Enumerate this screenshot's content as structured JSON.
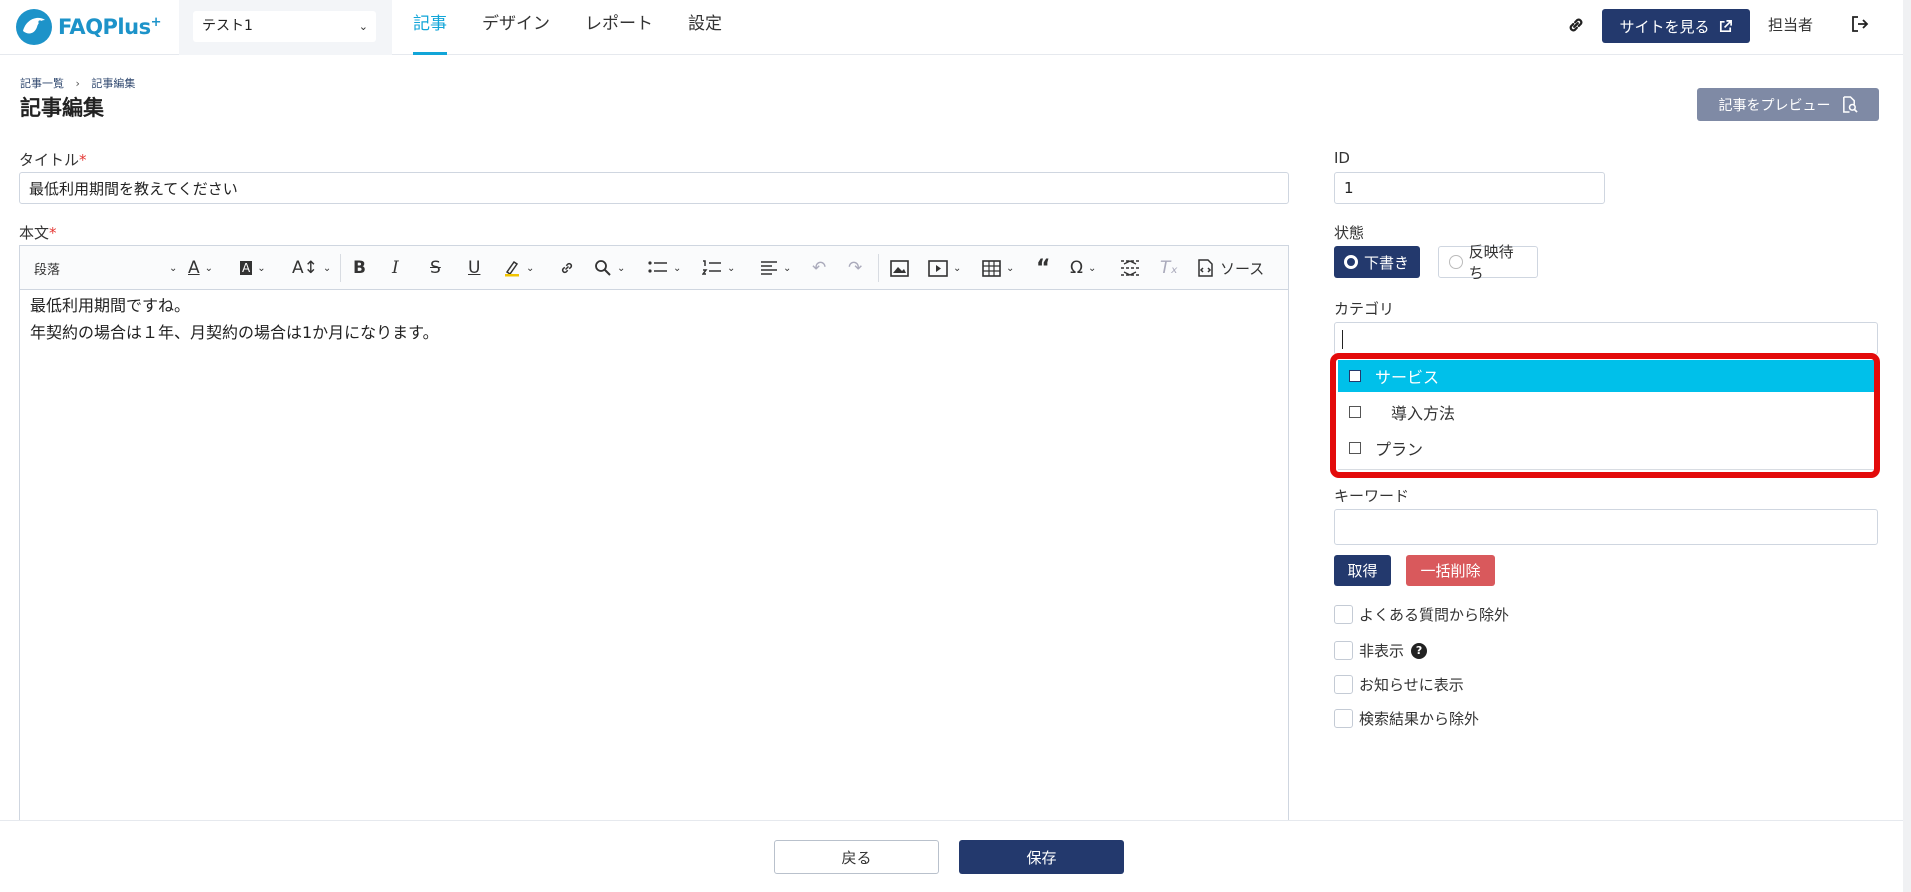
{
  "header": {
    "logo_text": "FAQPlus",
    "logo_sup": "+",
    "site_select": "テスト1",
    "tabs": [
      {
        "label": "記事"
      },
      {
        "label": "デザイン"
      },
      {
        "label": "レポート"
      },
      {
        "label": "設定"
      }
    ],
    "view_site_label": "サイトを見る",
    "owner_label": "担当者"
  },
  "breadcrumb": {
    "items": [
      "記事一覧",
      "記事編集"
    ],
    "separator": "›"
  },
  "page_title": "記事編集",
  "preview_label": "記事をプレビュー",
  "title_field": {
    "label": "タイトル",
    "required_mark": "*",
    "value": "最低利用期間を教えてください"
  },
  "body_field": {
    "label": "本文",
    "required_mark": "*",
    "toolbar": {
      "paragraph_label": "段落",
      "source_label": "ソース"
    },
    "lines": [
      "最低利用期間ですね。",
      "年契約の場合は１年、月契約の場合は1か月になります。"
    ]
  },
  "id_field": {
    "label": "ID",
    "value": "1"
  },
  "status": {
    "label": "状態",
    "options": [
      "下書き",
      "反映待ち"
    ],
    "selected": "下書き"
  },
  "category": {
    "label": "カテゴリ",
    "options": [
      {
        "label": "サービス",
        "highlighted": true
      },
      {
        "label": "導入方法",
        "indent": true
      },
      {
        "label": "プラン"
      }
    ]
  },
  "keyword": {
    "label": "キーワード",
    "get_label": "取得",
    "delete_all_label": "一括削除"
  },
  "checkboxes": [
    "よくある質問から除外",
    "非表示",
    "お知らせに表示",
    "検索結果から除外"
  ],
  "help_icon_char": "?",
  "footer": {
    "back_label": "戻る",
    "save_label": "保存"
  },
  "colors": {
    "primary": "#23396d",
    "accent": "#11a5d8",
    "highlight_row": "#00c0ea",
    "danger": "#d9595c",
    "annotation_box": "#e30b0b"
  }
}
